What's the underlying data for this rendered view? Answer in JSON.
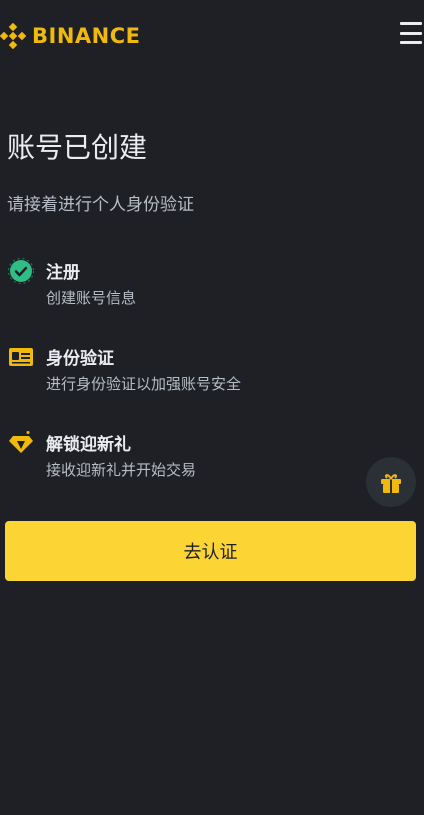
{
  "header": {
    "brand": "BINANCE",
    "logo_icon": "binance-logo-icon",
    "menu_icon": "hamburger-menu-icon"
  },
  "main": {
    "title": "账号已创建",
    "subtitle": "请接着进行个人身份验证",
    "steps": [
      {
        "icon": "check-circle-icon",
        "title": "注册",
        "desc": "创建账号信息",
        "status": "done"
      },
      {
        "icon": "id-card-icon",
        "title": "身份验证",
        "desc": "进行身份验证以加强账号安全",
        "status": "pending"
      },
      {
        "icon": "diamond-icon",
        "title": "解锁迎新礼",
        "desc": "接收迎新礼并开始交易",
        "status": "pending"
      }
    ],
    "cta_label": "去认证"
  },
  "floating": {
    "icon": "gift-icon"
  },
  "colors": {
    "background": "#1e2026",
    "accent": "#f0b90b",
    "button": "#fcd535",
    "success": "#2ebd85",
    "text_primary": "#eaecef",
    "text_secondary": "#b7bdc6"
  }
}
